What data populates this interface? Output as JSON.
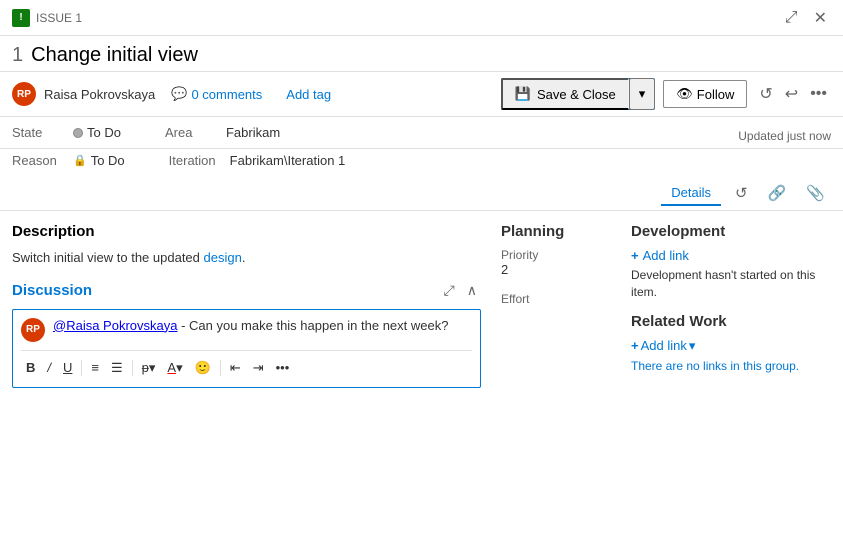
{
  "topbar": {
    "issue_label": "ISSUE 1",
    "expand_icon": "⤢",
    "close_icon": "✕"
  },
  "title": {
    "number": "1",
    "text": "Change initial view"
  },
  "toolbar": {
    "author": "Raisa Pokrovskaya",
    "comments_count": "0 comments",
    "add_tag": "Add tag",
    "save_close": "Save & Close",
    "follow": "Follow",
    "more_icon": "•••"
  },
  "fields": {
    "state_label": "State",
    "state_value": "To Do",
    "reason_label": "Reason",
    "reason_value": "To Do",
    "area_label": "Area",
    "area_value": "Fabrikam",
    "iteration_label": "Iteration",
    "iteration_value": "Fabrikam\\Iteration 1",
    "updated": "Updated just now"
  },
  "tabs": {
    "details": "Details",
    "history_icon": "↺",
    "link_icon": "🔗",
    "attachment_icon": "📎"
  },
  "description": {
    "title": "Description",
    "text_before": "Switch initial view to the updated ",
    "link_text": "design",
    "text_after": "."
  },
  "discussion": {
    "title": "Discussion",
    "expand_icon": "⤢",
    "collapse_icon": "∧",
    "author_mention": "@Raisa Pokrovskaya",
    "comment_text": " - Can you make this happen in the next week?"
  },
  "planning": {
    "title": "Planning",
    "priority_label": "Priority",
    "priority_value": "2",
    "effort_label": "Effort"
  },
  "development": {
    "title": "Development",
    "add_link": "Add link",
    "note": "Development hasn't started on this item.",
    "related_title": "Related Work",
    "add_link2": "Add link",
    "related_note_before": "There are no links ",
    "related_note_link": "in this group",
    "related_note_after": "."
  }
}
